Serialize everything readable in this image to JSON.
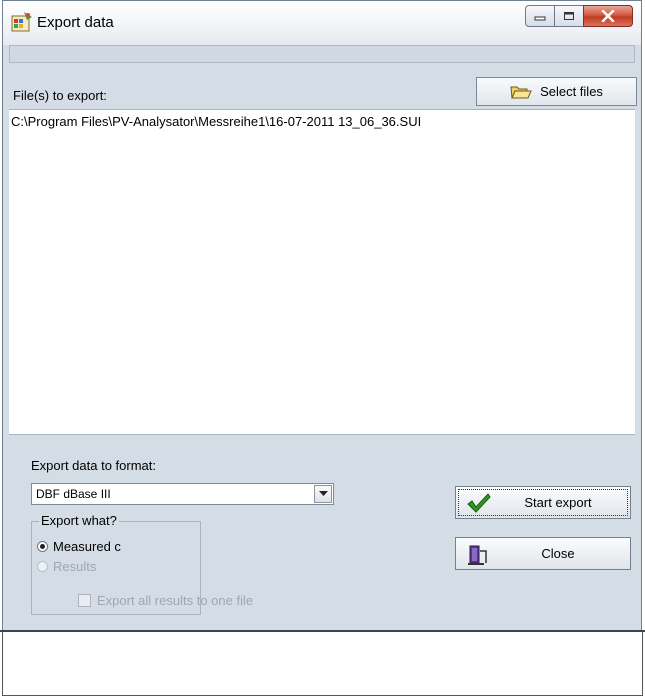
{
  "window": {
    "title": "Export data"
  },
  "files": {
    "label": "File(s) to export:",
    "select_button": "Select files",
    "entries": [
      "C:\\Program Files\\PV-Analysator\\Messreihe1\\16-07-2011  13_06_36.SUI"
    ]
  },
  "format": {
    "label": "Export data to format:",
    "selected": "DBF dBase III"
  },
  "export_what": {
    "title": "Export what?",
    "options": [
      {
        "label": "Measured c",
        "checked": true,
        "enabled": true
      },
      {
        "label": "Results",
        "checked": false,
        "enabled": false
      }
    ],
    "one_file_label": "Export all results to one file"
  },
  "buttons": {
    "start_export": "Start export",
    "close": "Close"
  },
  "colors": {
    "dialog_bg": "#d4dce6",
    "close_button_red": "#c03a22",
    "check_green": "#2a9a1e"
  },
  "icons": {
    "app": "app-palette-icon",
    "select_files": "folder-open-icon",
    "start_export": "checkmark-icon",
    "close": "door-exit-icon"
  }
}
